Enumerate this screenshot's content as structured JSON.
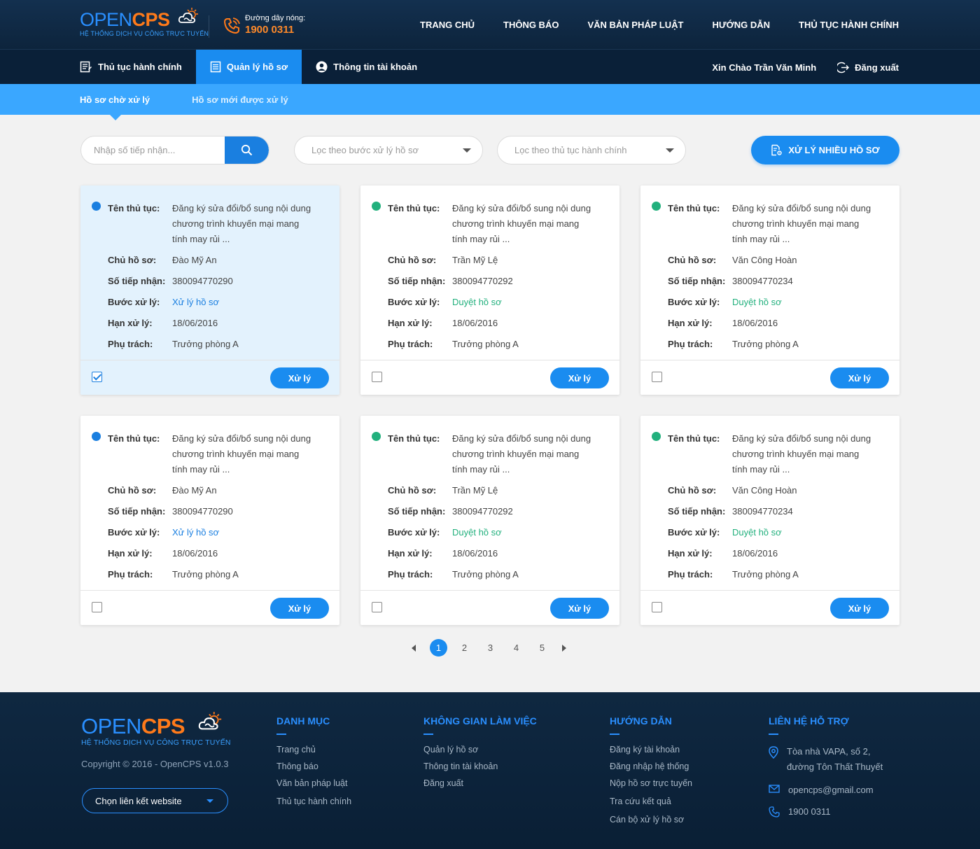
{
  "header": {
    "logo_open": "OPEN",
    "logo_cps": "CPS",
    "logo_sub": "HỆ THỐNG DỊCH VỤ CÔNG TRỰC TUYẾN",
    "hotline_title": "Đường dây nóng:",
    "hotline_number": "1900 0311",
    "nav": [
      "TRANG CHỦ",
      "THÔNG BÁO",
      "VĂN BẢN PHÁP LUẬT",
      "HƯỚNG DẪN",
      "THỦ TỤC HÀNH CHÍNH"
    ]
  },
  "subnav": {
    "items": [
      "Thủ tục hành chính",
      "Quản lý hồ sơ",
      "Thông tin tài khoản"
    ],
    "active_index": 1,
    "greeting": "Xin Chào Trần Văn Minh",
    "logout": "Đăng xuất"
  },
  "tabs": [
    "Hồ sơ chờ xử lý",
    "Hồ sơ mới được xử lý"
  ],
  "filters": {
    "search_placeholder": "Nhập số tiếp nhận...",
    "step_filter": "Lọc theo bước xử lý hồ sơ",
    "procedure_filter": "Lọc theo thủ tục hành chính",
    "bulk_button": "XỬ LÝ NHIỀU HỒ SƠ"
  },
  "card_labels": {
    "procedure": "Tên thủ tục:",
    "owner": "Chủ hồ sơ:",
    "receipt": "Số tiếp nhận:",
    "step": "Bước xử lý:",
    "deadline": "Hạn xử lý:",
    "assignee": "Phụ trách:",
    "action": "Xử lý"
  },
  "cards": [
    {
      "dot_color": "#1a7fe0",
      "procedure": "Đăng ký sửa đổi/bổ sung nội dung chương trình khuyến mại mang tính may rủi ...",
      "owner": "Đào Mỹ An",
      "receipt": "380094770290",
      "step": "Xử lý hồ sơ",
      "step_color": "blue",
      "deadline": "18/06/2016",
      "assignee": "Trưởng phòng A",
      "checked": true
    },
    {
      "dot_color": "#22b07d",
      "procedure": "Đăng ký sửa đổi/bổ sung nội dung chương trình khuyến mại mang tính may rủi ...",
      "owner": "Trần Mỹ Lệ",
      "receipt": "380094770292",
      "step": "Duyệt hồ sơ",
      "step_color": "green",
      "deadline": "18/06/2016",
      "assignee": "Trưởng phòng A",
      "checked": false
    },
    {
      "dot_color": "#22b07d",
      "procedure": "Đăng ký sửa đổi/bổ sung nội dung chương trình khuyến mại mang tính may rủi ...",
      "owner": "Văn Công Hoàn",
      "receipt": "380094770234",
      "step": "Duyệt hồ sơ",
      "step_color": "green",
      "deadline": "18/06/2016",
      "assignee": "Trưởng phòng A",
      "checked": false
    },
    {
      "dot_color": "#1a7fe0",
      "procedure": "Đăng ký sửa đổi/bổ sung nội dung chương trình khuyến mại mang tính may rủi ...",
      "owner": "Đào Mỹ An",
      "receipt": "380094770290",
      "step": "Xử lý hồ sơ",
      "step_color": "blue",
      "deadline": "18/06/2016",
      "assignee": "Trưởng phòng A",
      "checked": false
    },
    {
      "dot_color": "#22b07d",
      "procedure": "Đăng ký sửa đổi/bổ sung nội dung chương trình khuyến mại mang tính may rủi ...",
      "owner": "Trần Mỹ Lệ",
      "receipt": "380094770292",
      "step": "Duyệt hồ sơ",
      "step_color": "green",
      "deadline": "18/06/2016",
      "assignee": "Trưởng phòng A",
      "checked": false
    },
    {
      "dot_color": "#22b07d",
      "procedure": "Đăng ký sửa đổi/bổ sung nội dung chương trình khuyến mại mang tính may rủi ...",
      "owner": "Văn Công Hoàn",
      "receipt": "380094770234",
      "step": "Duyệt hồ sơ",
      "step_color": "green",
      "deadline": "18/06/2016",
      "assignee": "Trưởng phòng A",
      "checked": false
    }
  ],
  "pagination": {
    "pages": [
      "1",
      "2",
      "3",
      "4",
      "5"
    ],
    "current": "1"
  },
  "footer": {
    "copyright": "Copyright © 2016 - OpenCPS v1.0.3",
    "site_select": "Chọn liên kết website",
    "col1": {
      "title": "DANH MỤC",
      "links": [
        "Trang chủ",
        "Thông báo",
        "Văn bản pháp luật",
        "Thủ tục hành chính"
      ]
    },
    "col2": {
      "title": "KHÔNG GIAN LÀM VIỆC",
      "links": [
        "Quản lý hồ sơ",
        "Thông tin tài khoản",
        "Đăng xuất"
      ]
    },
    "col3": {
      "title": "HƯỚNG DẪN",
      "links": [
        "Đăng ký tài khoản",
        "Đăng nhập hệ thống",
        "Nộp hồ sơ trực tuyến",
        "Tra cứu kết quả",
        "Cán bộ xử lý hồ sơ"
      ]
    },
    "col4": {
      "title": "LIÊN HỆ HỖ TRỢ",
      "address_line1": "Tòa nhà VAPA, số 2,",
      "address_line2": "đường Tôn Thất Thuyết",
      "email": "opencps@gmail.com",
      "phone": "1900 0311"
    }
  }
}
